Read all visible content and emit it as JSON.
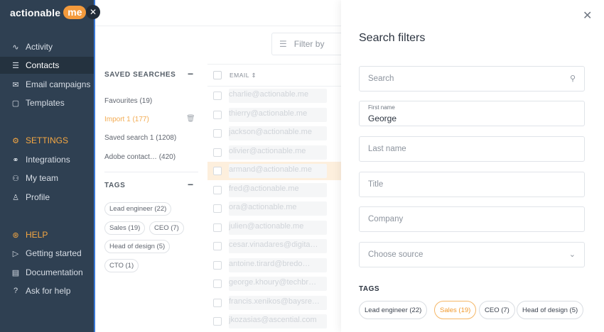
{
  "sidebar": {
    "logo_text": "actionable",
    "logo_badge": "me",
    "collapse_glyph": "✕",
    "nav": [
      {
        "label": "Activity",
        "icon": "activity-icon",
        "glyph": "∿"
      },
      {
        "label": "Contacts",
        "icon": "list-icon",
        "glyph": "☰",
        "active": true
      },
      {
        "label": "Email campaigns",
        "icon": "mail-icon",
        "glyph": "✉"
      },
      {
        "label": "Templates",
        "icon": "chat-icon",
        "glyph": "▢"
      }
    ],
    "settings_label": "SETTINGS",
    "settings": [
      {
        "label": "Integrations",
        "icon": "plug-icon",
        "glyph": "⚭"
      },
      {
        "label": "My team",
        "icon": "team-icon",
        "glyph": "⚇"
      },
      {
        "label": "Profile",
        "icon": "person-icon",
        "glyph": "♙"
      }
    ],
    "help_label": "HELP",
    "help": [
      {
        "label": "Getting started",
        "icon": "play-icon",
        "glyph": "▷"
      },
      {
        "label": "Documentation",
        "icon": "doc-icon",
        "glyph": "▤"
      },
      {
        "label": "Ask for help",
        "icon": "question-icon",
        "glyph": "?"
      }
    ]
  },
  "toolbar": {
    "filter_label": "Filter by"
  },
  "saved_searches": {
    "title": "SAVED SEARCHES",
    "collapse": "−",
    "items": [
      "Favourites (19)",
      "Import 1 (177)",
      "Saved search 1 (1208)",
      "Adobe contact… (420)"
    ]
  },
  "tags_section": {
    "title": "TAGS",
    "collapse": "−",
    "tags": [
      "Lead engineer (22)",
      "Sales (19)",
      "CEO (7)",
      "Head of design (5)",
      "CTO (1)"
    ]
  },
  "table": {
    "email_header": "EMAIL ⇕",
    "rows": [
      "charlie@actionable.me",
      "thierry@actionable.me",
      "jackson@actionable.me",
      "olivier@actionable.me",
      "armand@actionable.me",
      "fred@actionable.me",
      "ora@actionable.me",
      "julien@actionable.me",
      "cesar.vinadares@digita…",
      "antoine.tirard@bredo…",
      "george.khoury@techbr…",
      "francis.xenikos@baysre…",
      "jkozasias@ascential.com"
    ]
  },
  "panel": {
    "title": "Search filters",
    "close_glyph": "✕",
    "search_placeholder": "Search",
    "first_name_label": "First name",
    "first_name_value": "George",
    "last_name_placeholder": "Last name",
    "title_placeholder": "Title",
    "company_placeholder": "Company",
    "source_placeholder": "Choose source",
    "tags_title": "TAGS",
    "tags": [
      "Lead engineer (22)",
      "Sales (19)",
      "CEO (7)",
      "Head of design (5)"
    ]
  },
  "colors": {
    "sidebar_bg": "#2f4052",
    "accent_orange": "#f39a3c",
    "highlight_row": "#fdecd6"
  }
}
